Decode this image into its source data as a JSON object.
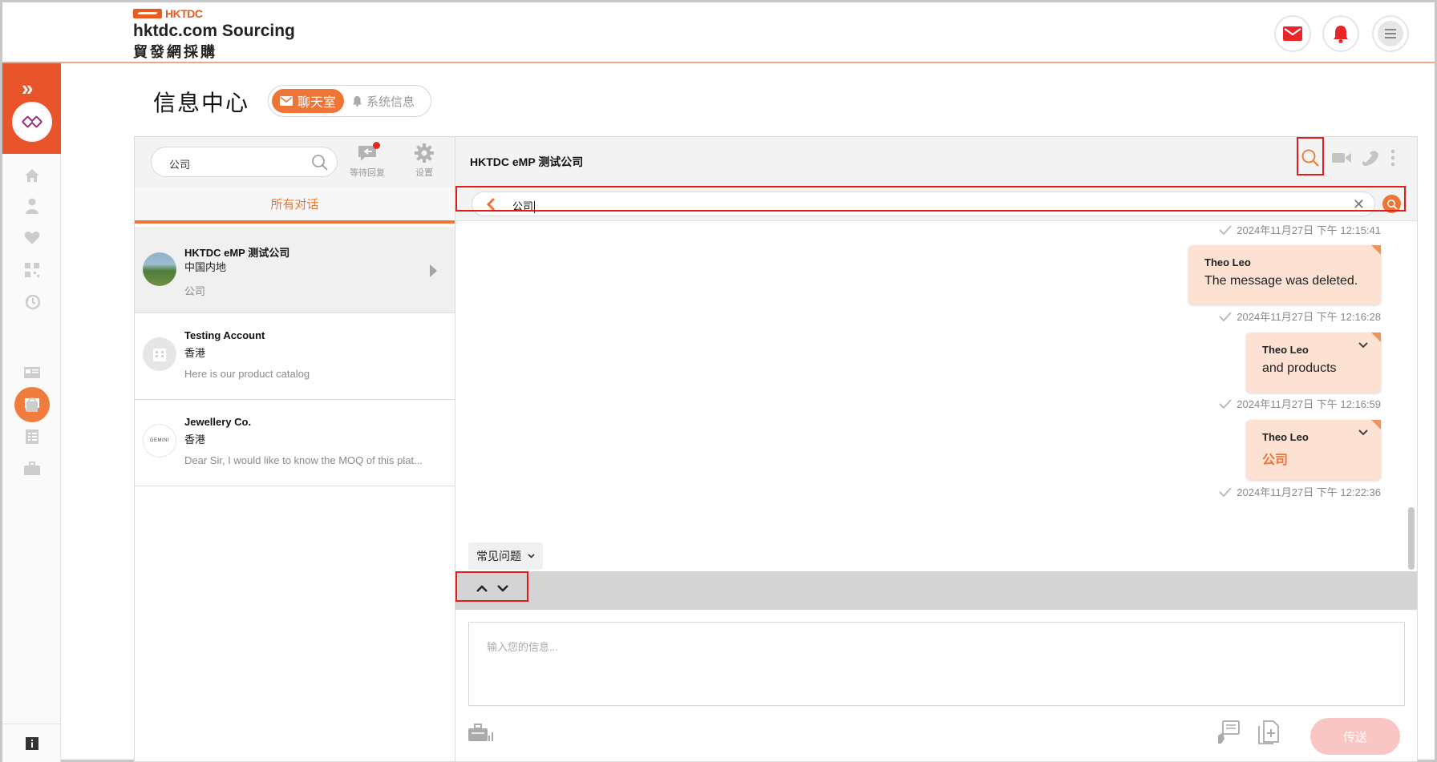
{
  "header": {
    "logo_mark": "HKTDC",
    "brand_line1": "hktdc.com Sourcing",
    "brand_line2": "貿發網採購",
    "icons": [
      "mail-icon",
      "bell-icon",
      "menu-icon"
    ],
    "accent": "#ee7535"
  },
  "rail": {
    "icons": [
      "home-icon",
      "user-icon",
      "heart-icon",
      "qr-icon",
      "history-icon",
      "chat-icon",
      "card-icon",
      "bag-icon",
      "list-icon",
      "briefcase-icon",
      "info-icon"
    ],
    "active": "chat-icon"
  },
  "page": {
    "title": "信息中心",
    "tab_chat": "聊天室",
    "tab_system": "系统信息"
  },
  "list": {
    "search_value": "公司",
    "pending_label": "等待回复",
    "settings_label": "设置",
    "tab_all": "所有对话",
    "conversations": [
      {
        "name": "HKTDC eMP 测试公司",
        "region": "中国内地",
        "preview": "公司"
      },
      {
        "name": "Testing Account",
        "region": "香港",
        "preview": "Here is our product catalog"
      },
      {
        "name": "Jewellery Co.",
        "region": "香港",
        "preview": "Dear Sir, I would like to know the MOQ of this plat...",
        "logo_text": "GEMINI"
      }
    ]
  },
  "chat": {
    "title": "HKTDC eMP 测试公司",
    "find_value": "公司",
    "messages": [
      {
        "timestamp": "2024年11月27日 下午 12:15:41"
      },
      {
        "sender": "Theo Leo",
        "text": "The message was deleted.",
        "timestamp": "2024年11月27日 下午 12:16:28"
      },
      {
        "sender": "Theo Leo",
        "text": "and products",
        "timestamp": "2024年11月27日 下午 12:16:59"
      },
      {
        "sender": "Theo Leo",
        "text": "公司",
        "timestamp": "2024年11月27日 下午 12:22:36"
      }
    ],
    "faq_label": "常见问题",
    "compose_placeholder": "输入您的信息...",
    "send_label": "传送"
  }
}
